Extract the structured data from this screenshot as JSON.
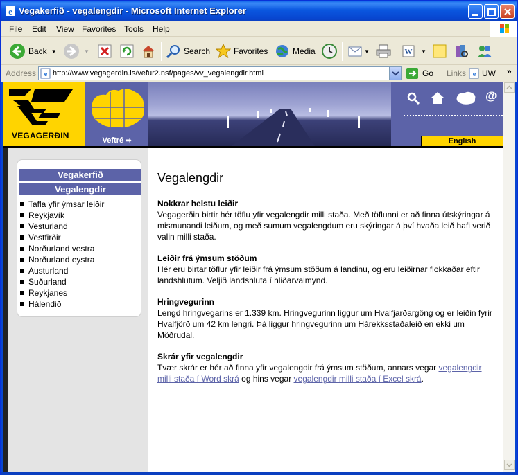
{
  "window": {
    "title": "Vegakerfið - vegalengdir - Microsoft Internet Explorer"
  },
  "menu": [
    "File",
    "Edit",
    "View",
    "Favorites",
    "Tools",
    "Help"
  ],
  "toolbar": {
    "back": "Back",
    "search": "Search",
    "favorites": "Favorites",
    "media": "Media"
  },
  "address": {
    "label": "Address",
    "url": "http://www.vegagerdin.is/vefur2.nsf/pages/vv_vegalengdir.html",
    "go": "Go",
    "links": "Links",
    "uw": "UW"
  },
  "banner": {
    "logo_text": "VEGAGERÐIN",
    "veftre": "Veftré",
    "english": "English"
  },
  "nav": {
    "heading1": "Vegakerfið",
    "heading2": "Vegalengdir",
    "items": [
      "Tafla yfir ýmsar leiðir",
      "Reykjavík",
      "Vesturland",
      "Vestfirðir",
      "Norðurland vestra",
      "Norðurland eystra",
      "Austurland",
      "Suðurland",
      "Reykjanes",
      "Hálendið"
    ]
  },
  "content": {
    "title": "Vegalengdir",
    "sections": [
      {
        "heading": "Nokkrar helstu leiðir",
        "body": "Vegagerðin birtir hér töflu yfir vegalengdir milli staða. Með töflunni er að finna útskýringar á mismunandi leiðum, og með sumum vegalengdum eru skýringar á því hvaða leið hafi verið valin milli staða."
      },
      {
        "heading": "Leiðir frá ýmsum stöðum",
        "body": "Hér eru birtar töflur yfir leiðir frá ýmsum stöðum á landinu, og eru leiðirnar flokkaðar eftir landshlutum. Veljið landshluta í hliðarvalmynd."
      },
      {
        "heading": "Hringvegurinn",
        "body": "Lengd hringvegarins er 1.339 km. Hringvegurinn liggur um Hvalfjarðargöng og er leiðin fyrir Hvalfjörð um 42 km lengri. Þá liggur hringvegurinn um Hárekksstaðaleið en ekki um Möðrudal."
      },
      {
        "heading": "Skrár yfir vegalengdir",
        "body_start": "Tvær skrár er hér að finna yfir vegalengdir frá ýmsum stöðum, annars vegar ",
        "link1": "vegalengdir milli staða í Word skrá",
        "body_mid": " og hins vegar ",
        "link2": "vegalengdir milli staða í Excel skrá",
        "body_end": "."
      }
    ]
  },
  "colors": {
    "brand_yellow": "#FFD400",
    "brand_blue": "#5C63A8",
    "xp_title_blue": "#0A57E0"
  }
}
